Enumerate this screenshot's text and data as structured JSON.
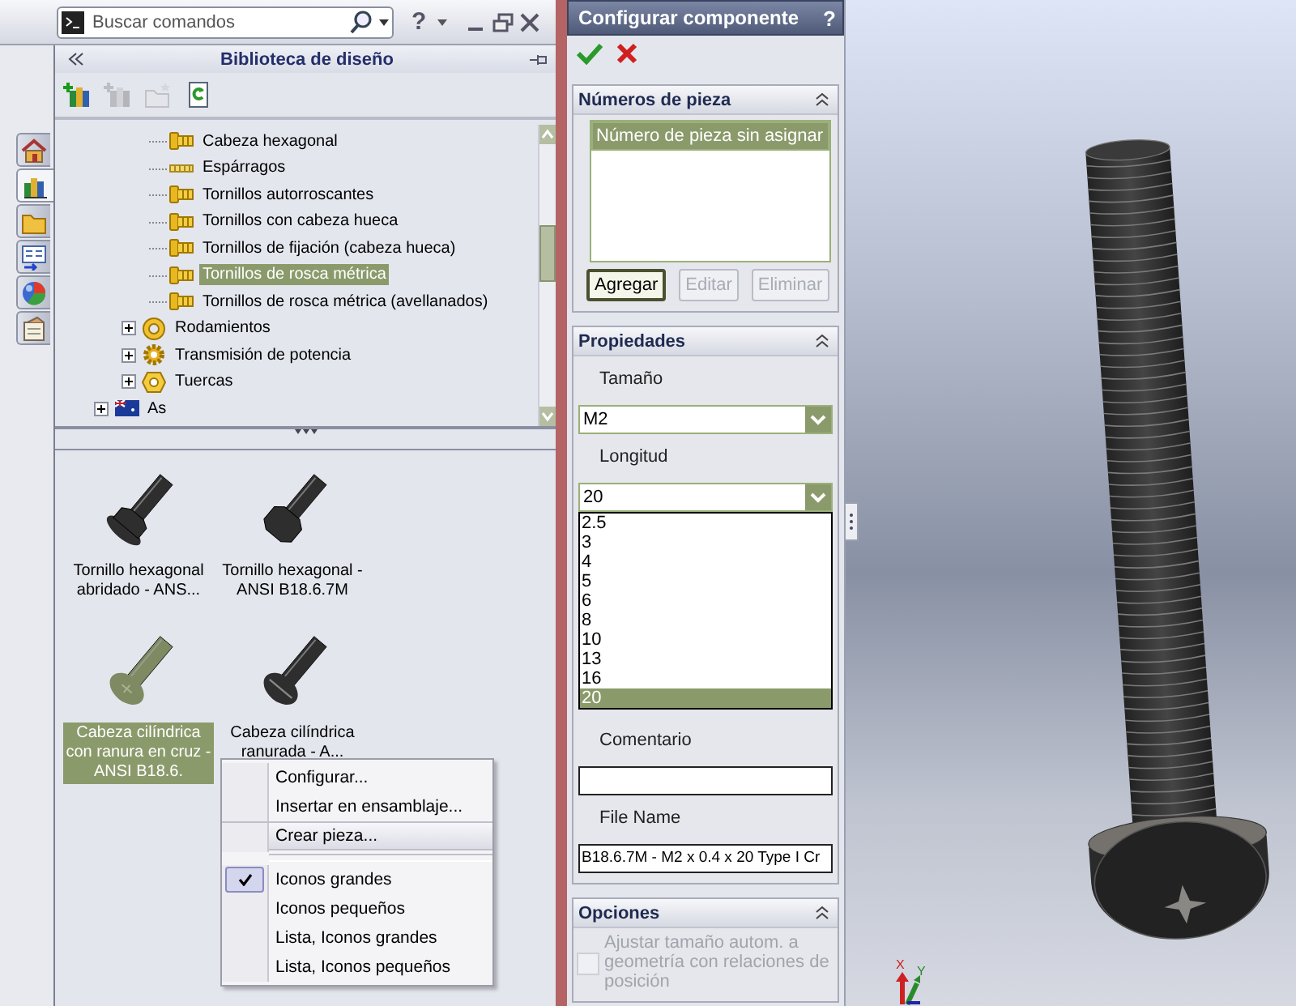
{
  "command_bar": {
    "search": {
      "placeholder": "Buscar comandos"
    },
    "help": "?"
  },
  "side_tabs": [
    {
      "kind": "home",
      "selected": false
    },
    {
      "kind": "library",
      "selected": true
    },
    {
      "kind": "files",
      "selected": false
    },
    {
      "kind": "view-palette",
      "selected": false
    },
    {
      "kind": "appearances",
      "selected": false
    },
    {
      "kind": "custom-properties",
      "selected": false
    }
  ],
  "library": {
    "title": "Biblioteca de diseño",
    "toolbar": [
      {
        "kind": "add-library",
        "disabled": false
      },
      {
        "kind": "add-library",
        "disabled": true
      },
      {
        "kind": "new-folder",
        "disabled": true
      },
      {
        "kind": "refresh",
        "disabled": false
      }
    ],
    "tree": [
      {
        "children": [
          {
            "children": [
              {
                "label": "Cabeza hexagonal",
                "kind": "bolt",
                "selected": false
              },
              {
                "label": "Espárragos",
                "kind": "stud",
                "selected": false
              },
              {
                "label": "Tornillos autorroscantes",
                "kind": "bolt",
                "selected": false
              },
              {
                "label": "Tornillos con cabeza hueca",
                "kind": "bolt",
                "selected": false
              },
              {
                "label": "Tornillos de fijación (cabeza hueca)",
                "kind": "bolt",
                "selected": false
              },
              {
                "label": "Tornillos de rosca métrica",
                "kind": "bolt",
                "selected": true
              },
              {
                "label": "Tornillos de rosca métrica (avellanados)",
                "kind": "bolt",
                "selected": false
              }
            ]
          },
          {
            "label": "Rodamientos",
            "kind": "bearing",
            "expanded": false,
            "selected": false
          },
          {
            "label": "Transmisión de potencia",
            "kind": "gear",
            "expanded": false,
            "selected": false
          },
          {
            "label": "Tuercas",
            "kind": "nut",
            "expanded": false,
            "selected": false
          }
        ]
      },
      {
        "label": "As",
        "kind": "flag",
        "expanded": false,
        "selected": false
      }
    ],
    "items": [
      {
        "label": "Tornillo hexagonal abridado - ANS...",
        "kind": "flanged-hex",
        "selected": false
      },
      {
        "label": "Tornillo hexagonal - ANSI B18.6.7M",
        "kind": "hex",
        "selected": false
      },
      {
        "label": "Cabeza cilíndrica con ranura en cruz - ANSI B18.6.",
        "kind": "cross",
        "selected": true
      },
      {
        "label": "Cabeza cilíndrica ranurada - A...",
        "kind": "slotted",
        "selected": false
      }
    ],
    "context_menu": {
      "groups": [
        [
          {
            "label": "Configurar...",
            "checked": false,
            "selected": false
          },
          {
            "label": "Insertar en ensamblaje...",
            "checked": false,
            "selected": false
          },
          {
            "label": "Crear pieza...",
            "checked": false,
            "selected": true
          }
        ],
        [
          {
            "label": "Iconos grandes",
            "checked": true,
            "selected": false
          },
          {
            "label": "Iconos pequeños",
            "checked": false,
            "selected": false
          },
          {
            "label": "Lista, Iconos grandes",
            "checked": false,
            "selected": false
          },
          {
            "label": "Lista, Iconos pequeños",
            "checked": false,
            "selected": false
          }
        ]
      ]
    }
  },
  "property_manager": {
    "title": "Configurar componente",
    "help": "?",
    "sections": [
      {
        "kind": "part-numbers",
        "title": "Números de pieza",
        "expanded": true,
        "list": [
          {
            "label": "Número de pieza sin asignar",
            "selected": true
          }
        ],
        "buttons": [
          {
            "label": "Agregar",
            "disabled": false
          },
          {
            "label": "Editar",
            "disabled": true
          },
          {
            "label": "Eliminar",
            "disabled": true
          }
        ]
      },
      {
        "kind": "properties",
        "title": "Propiedades",
        "expanded": true,
        "fields": [
          {
            "kind": "select",
            "label": "Tamaño",
            "value": "M2",
            "expanded": false
          },
          {
            "kind": "select",
            "label": "Longitud",
            "value": "20",
            "expanded": true,
            "options": [
              {
                "label": "2.5",
                "selected": false
              },
              {
                "label": "3",
                "selected": false
              },
              {
                "label": "4",
                "selected": false
              },
              {
                "label": "5",
                "selected": false
              },
              {
                "label": "6",
                "selected": false
              },
              {
                "label": "8",
                "selected": false
              },
              {
                "label": "10",
                "selected": false
              },
              {
                "label": "13",
                "selected": false
              },
              {
                "label": "16",
                "selected": false
              },
              {
                "label": "20",
                "selected": true
              }
            ]
          },
          {
            "kind": "text",
            "label": "Comentario"
          },
          {
            "kind": "text",
            "label": "File Name",
            "value": "B18.6.7M - M2 x 0.4 x 20 Type I Cr"
          }
        ]
      },
      {
        "kind": "options",
        "title": "Opciones",
        "expanded": true,
        "checkboxes": [
          {
            "label": "Ajustar tamaño autom. a geometría con relaciones de posición",
            "checked": false,
            "disabled": true
          }
        ]
      }
    ]
  },
  "viewport": {
    "triad": [
      "X",
      "Y"
    ]
  }
}
